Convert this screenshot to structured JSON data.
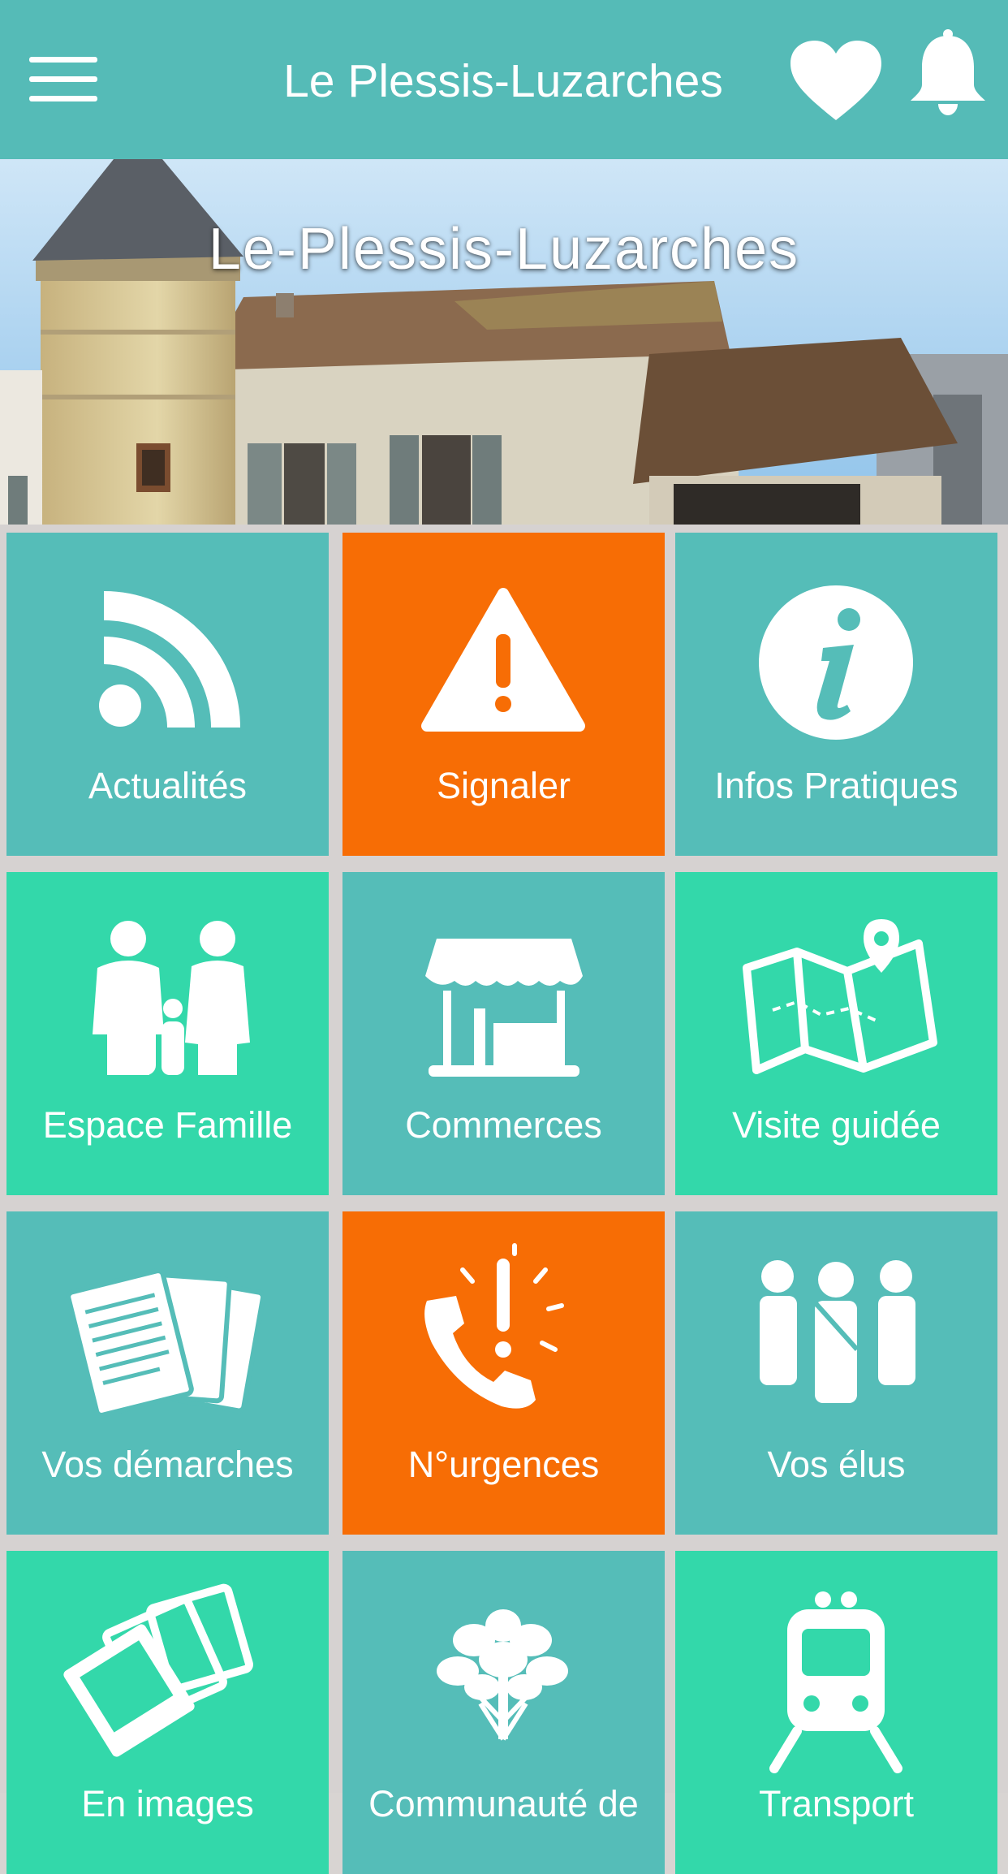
{
  "header": {
    "title": "Le Plessis-Luzarches",
    "menu_icon": "hamburger-menu-icon",
    "favorite_icon": "heart-icon",
    "notification_icon": "bell-icon",
    "background_color": "#55bbb7"
  },
  "hero": {
    "title": "Le-Plessis-Luzarches"
  },
  "colors": {
    "teal": "#55bdb8",
    "mint": "#33d8aa",
    "orange": "#f76d05"
  },
  "tiles": [
    {
      "label": "Actualités",
      "icon": "rss-feed-icon",
      "color": "teal"
    },
    {
      "label": "Signaler",
      "icon": "warning-icon",
      "color": "orange"
    },
    {
      "label": "Infos Pratiques",
      "icon": "info-icon",
      "color": "teal"
    },
    {
      "label": "Espace Famille",
      "icon": "family-icon",
      "color": "mint"
    },
    {
      "label": "Commerces",
      "icon": "shop-icon",
      "color": "teal"
    },
    {
      "label": "Visite guidée",
      "icon": "map-pin-icon",
      "color": "mint"
    },
    {
      "label": "Vos démarches",
      "icon": "documents-icon",
      "color": "teal"
    },
    {
      "label": "N°urgences",
      "icon": "emergency-phone-icon",
      "color": "orange"
    },
    {
      "label": "Vos élus",
      "icon": "officials-icon",
      "color": "teal"
    },
    {
      "label": "En images",
      "icon": "photos-icon",
      "color": "mint"
    },
    {
      "label": "Communauté de",
      "icon": "tree-icon",
      "color": "teal"
    },
    {
      "label": "Transport",
      "icon": "train-icon",
      "color": "mint"
    }
  ]
}
